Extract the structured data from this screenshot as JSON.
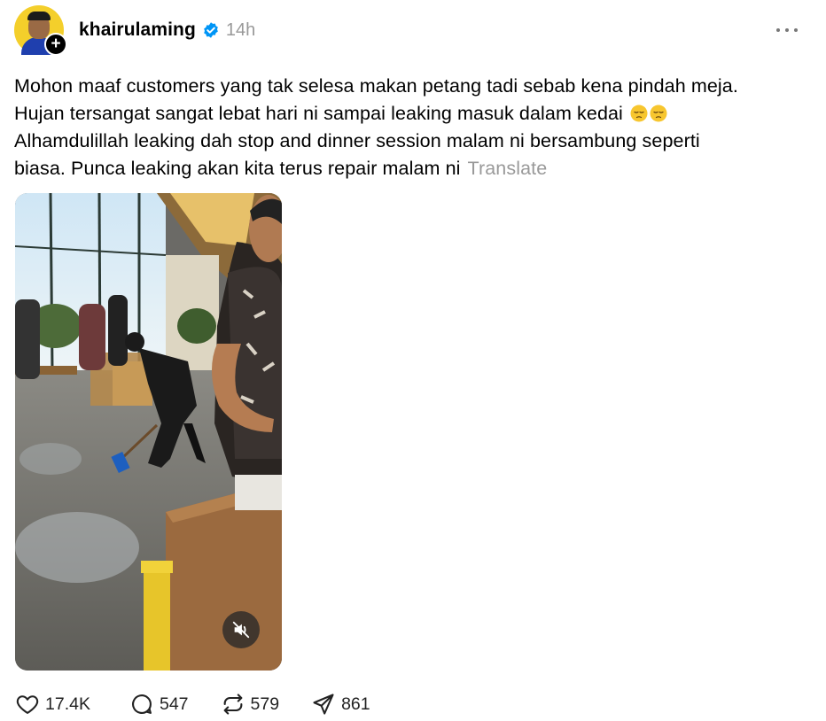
{
  "post": {
    "username": "khairulaming",
    "time": "14h",
    "text_lines": [
      "Mohon maaf customers yang tak selesa makan petang tadi sebab kena pindah meja.",
      "Hujan tersangat sangat lebat hari ni sampai leaking masuk dalam kedai",
      "Alhamdulillah leaking dah stop and dinner session malam ni bersambung seperti",
      "biasa. Punca leaking akan kita terus repair malam ni"
    ],
    "emoji": [
      "😔",
      "😔"
    ],
    "translate_label": "Translate"
  },
  "stats": {
    "likes": "17.4K",
    "comments": "547",
    "reposts": "579",
    "shares": "861"
  },
  "icons": {
    "avatar": "avatar",
    "follow": "plus-icon",
    "verified": "verified-badge-icon",
    "more": "more-options-icon",
    "mute": "speaker-muted-icon",
    "like": "heart-icon",
    "comment": "comment-bubble-icon",
    "repost": "repost-icon",
    "share": "send-icon"
  },
  "colors": {
    "verified": "#0095f6",
    "muted_text": "#999999",
    "avatar_bg": "#f4cf2b"
  }
}
